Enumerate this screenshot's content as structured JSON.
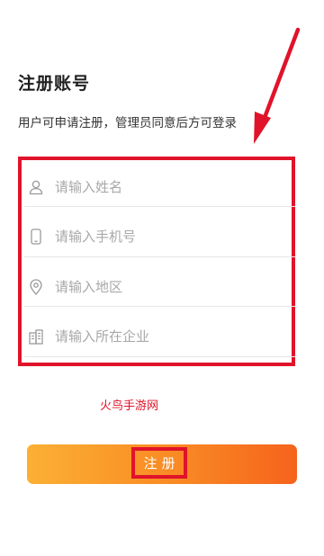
{
  "page": {
    "title": "注册账号",
    "subtitle": "用户可申请注册，管理员同意后方可登录"
  },
  "form": {
    "fields": [
      {
        "name": "name",
        "placeholder": "请输入姓名",
        "icon": "user-icon"
      },
      {
        "name": "phone",
        "placeholder": "请输入手机号",
        "icon": "phone-icon"
      },
      {
        "name": "region",
        "placeholder": "请输入地区",
        "icon": "location-pin-icon"
      },
      {
        "name": "company",
        "placeholder": "请输入所在企业",
        "icon": "building-icon"
      }
    ]
  },
  "watermark": "火鸟手游网",
  "actions": {
    "register_label": "注册"
  },
  "colors": {
    "highlight": "#e0132a",
    "button_start": "#fbb034",
    "button_end": "#f6631c",
    "placeholder": "#a8a8a8",
    "icon": "#9a9a9a"
  }
}
